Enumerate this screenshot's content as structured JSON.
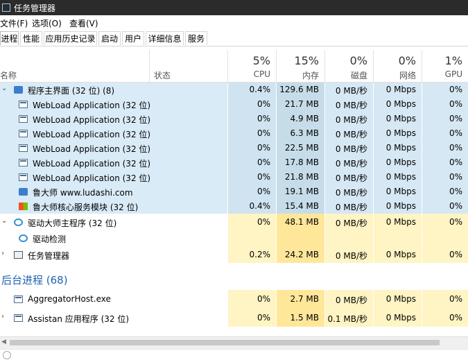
{
  "window": {
    "title": "任务管理器"
  },
  "menu": [
    "文件(F)",
    "选项(O)",
    "查看(V)"
  ],
  "tabs": [
    "进程",
    "性能",
    "应用历史记录",
    "启动",
    "用户",
    "详细信息",
    "服务"
  ],
  "header": {
    "name": "名称",
    "status": "状态",
    "cpu": {
      "pct": "5%",
      "label": "CPU"
    },
    "mem": {
      "pct": "15%",
      "label": "内存"
    },
    "disk": {
      "pct": "0%",
      "label": "磁盘"
    },
    "net": {
      "pct": "0%",
      "label": "网络"
    },
    "gpu": {
      "pct": "1%",
      "label": "GPU"
    }
  },
  "rows": [
    {
      "kind": "group",
      "name": "程序主界面 (32 位) (8)",
      "cpu": "0.4%",
      "mem": "129.6 MB",
      "disk": "0 MB/秒",
      "net": "0 Mbps",
      "gpu": "0%",
      "icon": "app-icon",
      "selected": true
    },
    {
      "kind": "child",
      "name": "WebLoad Application (32 位)",
      "cpu": "0%",
      "mem": "21.7 MB",
      "disk": "0 MB/秒",
      "net": "0 Mbps",
      "gpu": "0%",
      "icon": "window-icon",
      "selected": true
    },
    {
      "kind": "child",
      "name": "WebLoad Application (32 位)",
      "cpu": "0%",
      "mem": "4.9 MB",
      "disk": "0 MB/秒",
      "net": "0 Mbps",
      "gpu": "0%",
      "icon": "window-icon",
      "selected": true
    },
    {
      "kind": "child",
      "name": "WebLoad Application (32 位)",
      "cpu": "0%",
      "mem": "6.3 MB",
      "disk": "0 MB/秒",
      "net": "0 Mbps",
      "gpu": "0%",
      "icon": "window-icon",
      "selected": true
    },
    {
      "kind": "child",
      "name": "WebLoad Application (32 位)",
      "cpu": "0%",
      "mem": "22.5 MB",
      "disk": "0 MB/秒",
      "net": "0 Mbps",
      "gpu": "0%",
      "icon": "window-icon",
      "selected": true
    },
    {
      "kind": "child",
      "name": "WebLoad Application (32 位)",
      "cpu": "0%",
      "mem": "17.8 MB",
      "disk": "0 MB/秒",
      "net": "0 Mbps",
      "gpu": "0%",
      "icon": "window-icon",
      "selected": true
    },
    {
      "kind": "child",
      "name": "WebLoad Application (32 位)",
      "cpu": "0%",
      "mem": "21.8 MB",
      "disk": "0 MB/秒",
      "net": "0 Mbps",
      "gpu": "0%",
      "icon": "window-icon",
      "selected": true
    },
    {
      "kind": "child",
      "name": "鲁大师 www.ludashi.com",
      "cpu": "0%",
      "mem": "19.1 MB",
      "disk": "0 MB/秒",
      "net": "0 Mbps",
      "gpu": "0%",
      "icon": "app-icon",
      "selected": true
    },
    {
      "kind": "child",
      "name": "鲁大师核心服务模块 (32 位)",
      "cpu": "0.4%",
      "mem": "15.4 MB",
      "disk": "0 MB/秒",
      "net": "0 Mbps",
      "gpu": "0%",
      "icon": "windows-flag-icon",
      "selected": true
    },
    {
      "kind": "group",
      "name": "驱动大师主程序 (32 位)",
      "cpu": "0%",
      "mem": "48.1 MB",
      "disk": "0 MB/秒",
      "net": "0 Mbps",
      "gpu": "0%",
      "icon": "driver-icon",
      "selected": false
    },
    {
      "kind": "child",
      "name": "驱动检测",
      "cpu": "",
      "mem": "",
      "disk": "",
      "net": "",
      "gpu": "",
      "icon": "driver-icon",
      "selected": false
    },
    {
      "kind": "collapsed",
      "name": "任务管理器",
      "cpu": "0.2%",
      "mem": "24.2 MB",
      "disk": "0 MB/秒",
      "net": "0 Mbps",
      "gpu": "0%",
      "icon": "task-manager-icon",
      "selected": false
    },
    {
      "kind": "section",
      "name": "后台进程 (68)"
    },
    {
      "kind": "plain",
      "name": "AggregatorHost.exe",
      "cpu": "0%",
      "mem": "2.7 MB",
      "disk": "0 MB/秒",
      "net": "0 Mbps",
      "gpu": "0%",
      "icon": "window-icon",
      "selected": false
    },
    {
      "kind": "collapsed",
      "name": "Assistan 应用程序 (32 位)",
      "cpu": "0%",
      "mem": "1.5 MB",
      "disk": "0.1 MB/秒",
      "net": "0 Mbps",
      "gpu": "0%",
      "icon": "window-icon",
      "selected": false
    }
  ],
  "colors": {
    "selected_name": "#d9ebf7",
    "selected_cpu": "#cfe4f0",
    "selected_mem": "#c6dde9",
    "selected_other": "#d6e8f4",
    "heat_cpu": "#fff4c4",
    "heat_mem": "#ffe79a",
    "heat_other": "#fff4c4",
    "group_title": "#1f64b0"
  }
}
